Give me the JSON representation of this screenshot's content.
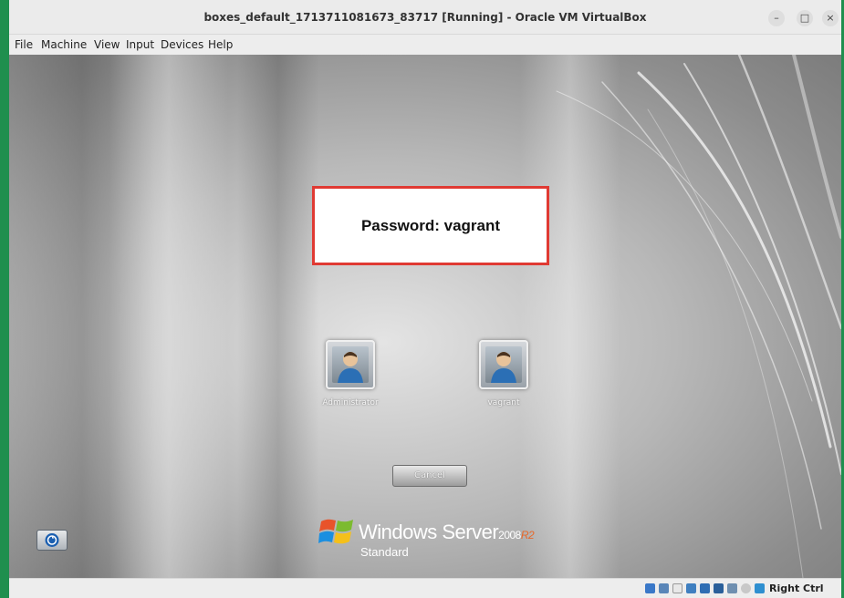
{
  "window": {
    "title": "boxes_default_1713711081673_83717 [Running] - Oracle VM VirtualBox",
    "controls": {
      "minimize": "–",
      "maximize": "□",
      "close": "×"
    }
  },
  "menu": {
    "items": [
      {
        "label": "File"
      },
      {
        "label": "Machine"
      },
      {
        "label": "View"
      },
      {
        "label": "Input"
      },
      {
        "label": "Devices"
      },
      {
        "label": "Help"
      }
    ]
  },
  "guest_screen": {
    "annotation": "Password: vagrant",
    "users": [
      {
        "name": "Administrator"
      },
      {
        "name": "vagrant"
      }
    ],
    "cancel_label": "Cancel",
    "brand": {
      "name": "Windows Server",
      "year": "2008",
      "release": "R2",
      "edition": "Standard"
    }
  },
  "status_bar": {
    "icons": [
      "hard-disk-icon",
      "optical-drive-icon",
      "floppy-icon",
      "network-icon",
      "usb-icon",
      "shared-folder-icon",
      "display-icon",
      "recording-icon",
      "cpu-icon"
    ],
    "host_key": "Right Ctrl"
  },
  "colors": {
    "accent_green": "#1f8f4e",
    "annotation_border": "#e03a33",
    "brand_r2": "#e7682a"
  }
}
